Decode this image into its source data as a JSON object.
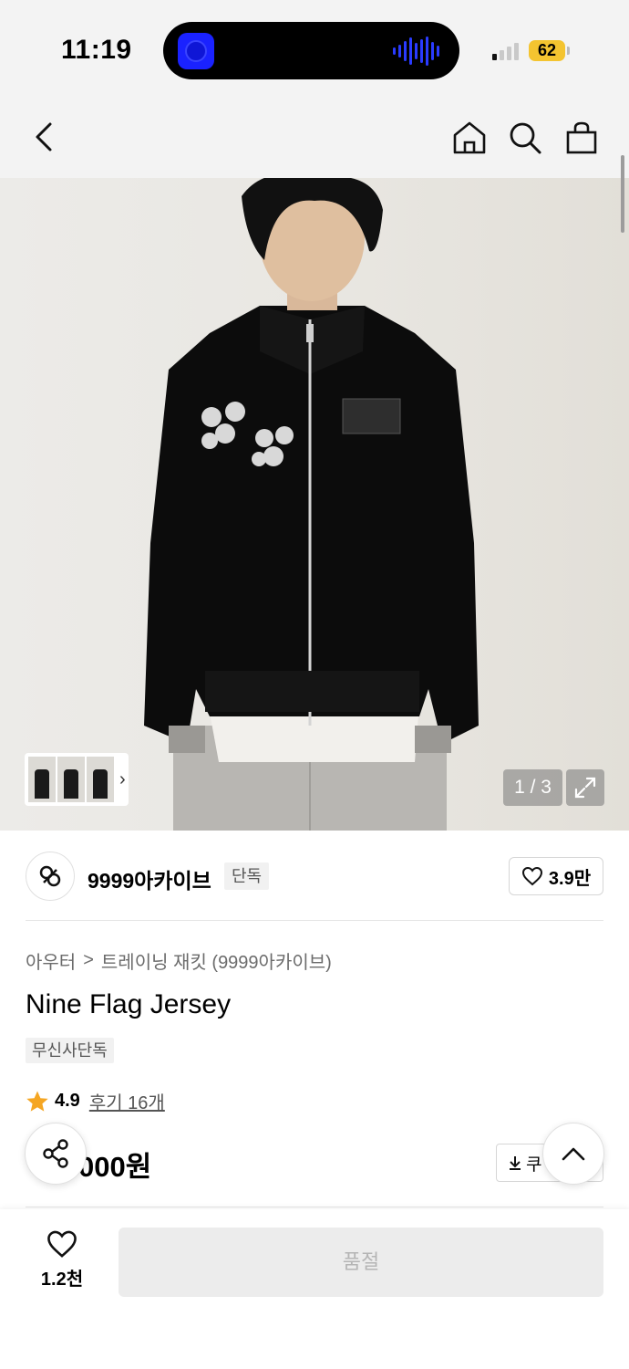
{
  "status_bar": {
    "time": "11:19",
    "battery": "62",
    "island_app_icon": "music-app-icon",
    "accent_battery": "#f4c430"
  },
  "nav": {
    "back_icon": "chevron-left-icon",
    "home_icon": "home-icon",
    "search_icon": "search-icon",
    "cart_icon": "shopping-bag-icon"
  },
  "gallery": {
    "counter": "1 / 3",
    "thumb_chevron": "›",
    "expand_icon": "expand-icon"
  },
  "brand": {
    "name": "9999아카이브",
    "badge": "단독",
    "likes": "3.9만"
  },
  "product": {
    "breadcrumb": [
      "아우터",
      "트레이닝 재킷 (9999아카이브)"
    ],
    "breadcrumb_separator": ">",
    "title": "Nine Flag Jersey",
    "tag": "무신사단독",
    "rating": "4.9",
    "reviews": "후기 16개",
    "price_visible": "000원",
    "coupon_label": "쿠"
  },
  "bottom_bar": {
    "wish_count": "1.2천",
    "soldout_label": "품절"
  },
  "colors": {
    "star": "#f5a623",
    "soldout_bg": "#ececec",
    "soldout_text": "#b5b5b5"
  }
}
